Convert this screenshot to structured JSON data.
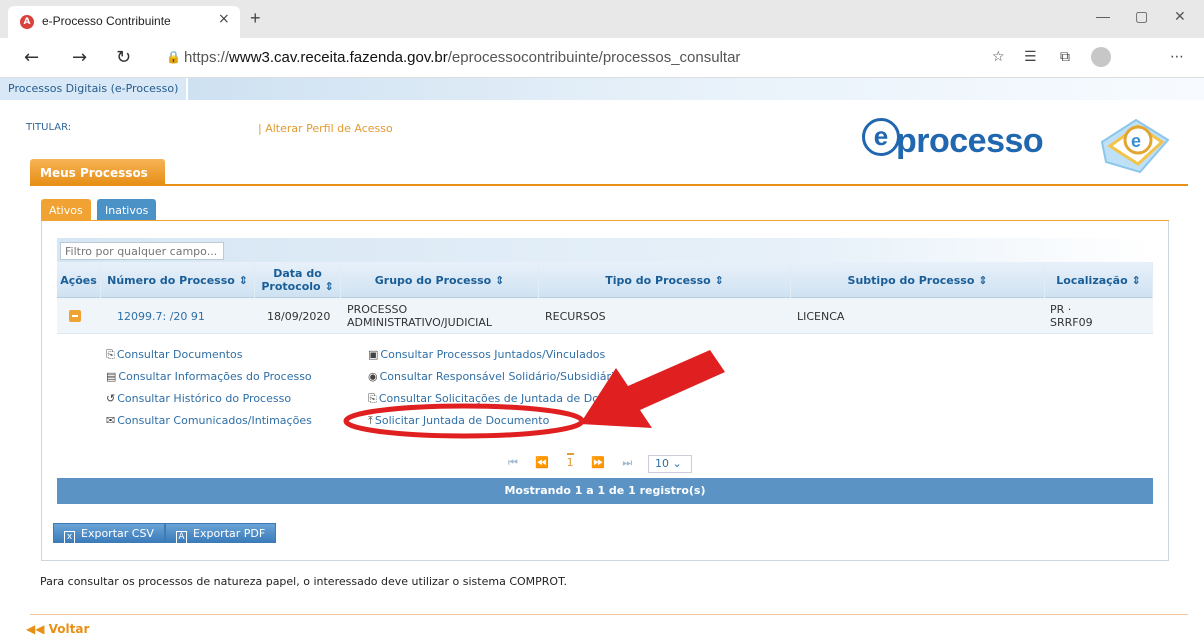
{
  "browser": {
    "tab_title": "e-Processo Contribuinte",
    "tab_close": "×",
    "new_tab": "+",
    "url_prefix": "https://",
    "url_host": "www3.cav.receita.fazenda.gov.br",
    "url_path": "/eprocessocontribuinte/processos_consultar"
  },
  "header": {
    "strip_label": "Processos Digitais (e-Processo)",
    "titular_label": "TITULAR:",
    "alterar_perfil": "| Alterar Perfil de Acesso",
    "logo_text": "processo",
    "logo_e": "e"
  },
  "tabs": {
    "main": "Meus Processos",
    "ativos": "Ativos",
    "inativos": "Inativos"
  },
  "filter": {
    "placeholder": "Filtro por qualquer campo..."
  },
  "table": {
    "headers": {
      "acoes": "Ações",
      "numero": "Número do Processo ⇕",
      "data": "Data do Protocolo ⇕",
      "grupo": "Grupo do Processo ⇕",
      "tipo": "Tipo do Processo ⇕",
      "subtipo": "Subtipo do Processo ⇕",
      "localizacao": "Localização ⇕"
    },
    "row": {
      "numero": "12099.7:      /20   91",
      "data": "18/09/2020",
      "grupo": "PROCESSO ADMINISTRATIVO/JUDICIAL",
      "tipo": "RECURSOS",
      "subtipo": "LICENCA",
      "localizacao": "PR · SRRF09"
    }
  },
  "actions_left": [
    "Consultar Documentos",
    "Consultar Informações do Processo",
    "Consultar Histórico do Processo",
    "Consultar Comunicados/Intimações"
  ],
  "actions_right": [
    "Consultar Processos Juntados/Vinculados",
    "Consultar Responsável Solidário/Subsidiário",
    "Consultar Solicitações de Juntada de Docum",
    "Solicitar Juntada de Documento"
  ],
  "pager": {
    "current": "1",
    "page_size": "10 ⌄"
  },
  "footer": {
    "showing": "Mostrando 1 a 1 de 1 registro(s)"
  },
  "export": {
    "csv": "Exportar CSV",
    "pdf": "Exportar PDF"
  },
  "note": "Para consultar os processos de natureza papel, o interessado deve utilizar o sistema COMPROT.",
  "voltar": "Voltar",
  "colors": {
    "orange": "#e78f16",
    "blue": "#2067b0",
    "annotation_red": "#e02020"
  }
}
